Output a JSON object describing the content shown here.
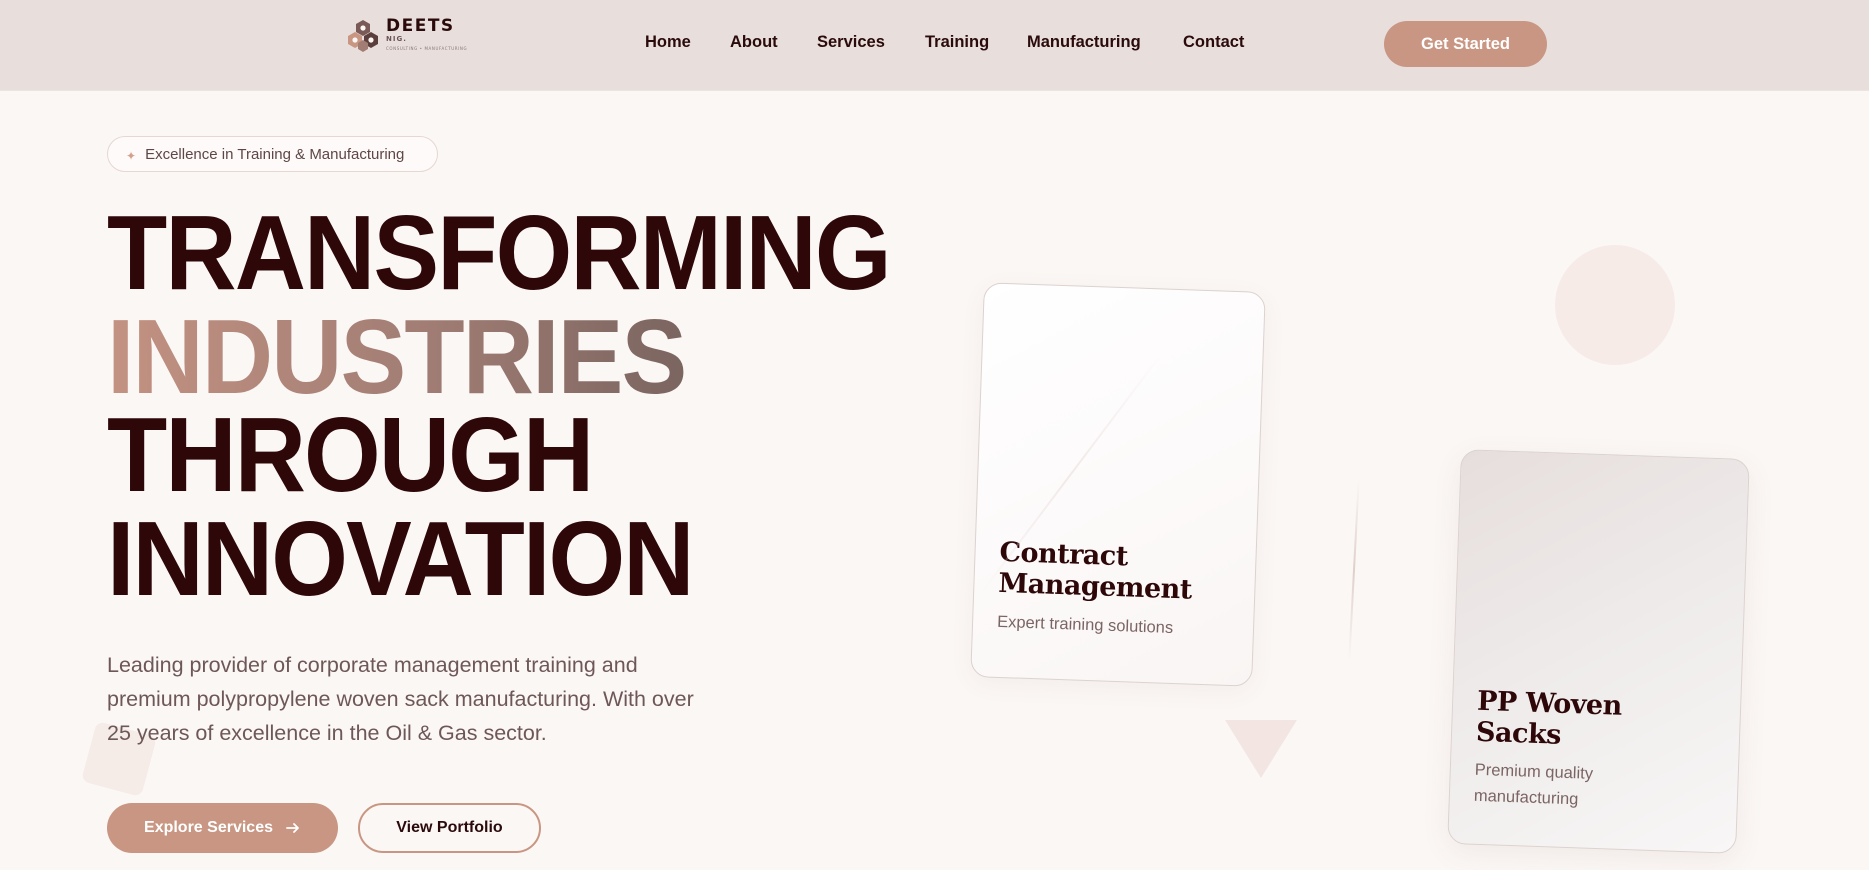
{
  "brand": {
    "name": "DEETS",
    "sub": "NIG.",
    "tagline": "CONSULTING • MANUFACTURING"
  },
  "nav": {
    "links": [
      "Home",
      "About",
      "Services",
      "Training",
      "Manufacturing",
      "Contact"
    ],
    "cta_label": "Get Started"
  },
  "hero": {
    "badge": "Excellence in Training & Manufacturing",
    "badge_icon": "sparkle-icon",
    "headline": [
      "TRANSFORMING",
      "INDUSTRIES",
      "THROUGH",
      "INNOVATION"
    ],
    "description": "Leading provider of corporate management training and premium polypropylene woven sack manufacturing. With over 25 years of excellence in the Oil & Gas sector.",
    "primary_button": "Explore Services",
    "primary_button_icon": "arrow-right-icon",
    "secondary_button": "View Portfolio"
  },
  "cards": [
    {
      "title": "Contract Management",
      "subtitle": "Expert training solutions"
    },
    {
      "title": "PP Woven Sacks",
      "subtitle": "Premium quality manufacturing"
    }
  ],
  "colors": {
    "accent": "#c89682",
    "navbar_bg": "#e8dfdd",
    "page_bg": "#fbf7f5",
    "heading": "#2e0808",
    "gradient_start": "#c39282",
    "gradient_end": "#7b6560"
  }
}
